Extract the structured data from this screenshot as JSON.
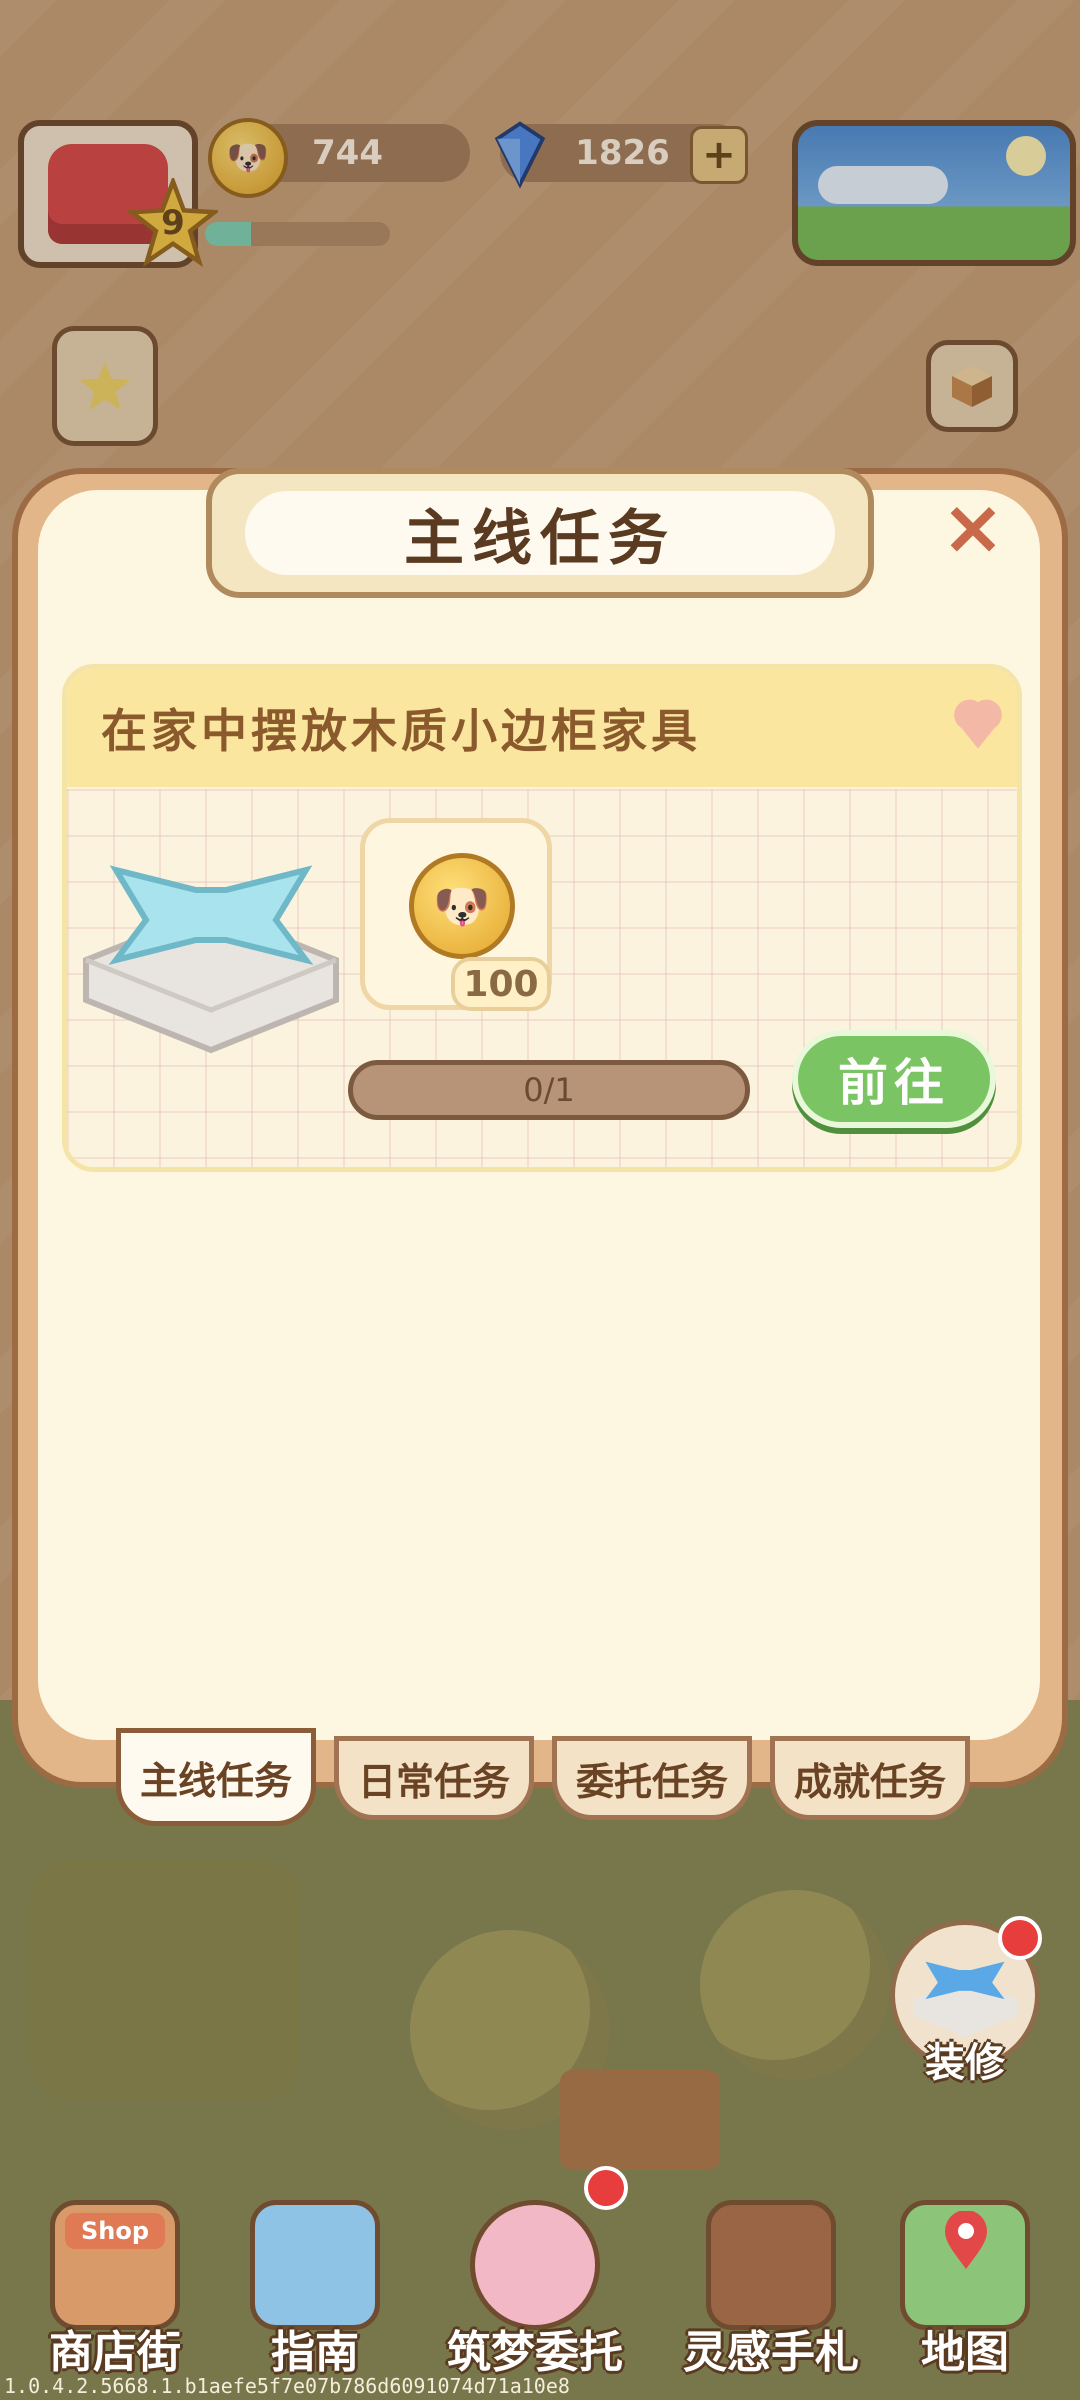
{
  "hud": {
    "level": "9",
    "xp_progress": 0.25,
    "coins": "744",
    "gems": "1826",
    "add_label": "+"
  },
  "modal": {
    "title": "主线任务",
    "close_label": "×",
    "task": {
      "description": "在家中摆放木质小边柜家具",
      "reward_quantity": "100",
      "progress_text": "0/1",
      "progress_value": 0,
      "go_button": "前往"
    },
    "tabs": [
      {
        "label": "主线任务",
        "active": true
      },
      {
        "label": "日常任务",
        "active": false
      },
      {
        "label": "委托任务",
        "active": false
      },
      {
        "label": "成就任务",
        "active": false
      }
    ]
  },
  "side": {
    "decorate_label": "装修"
  },
  "bottom_nav": [
    {
      "label": "商店街",
      "icon": "shop-icon",
      "badge": "Shop"
    },
    {
      "label": "指南",
      "icon": "guide-icon"
    },
    {
      "label": "筑梦委托",
      "icon": "notebook-icon"
    },
    {
      "label": "灵感手札",
      "icon": "quill-book-icon"
    },
    {
      "label": "地图",
      "icon": "map-icon"
    }
  ],
  "version": "1.0.4.2.5668.1.b1aefe5f7e07b786d6091074d71a10e8",
  "colors": {
    "accent_green": "#7bc463",
    "title_brown": "#5a3a20",
    "card_yellow": "#fbe69f"
  }
}
